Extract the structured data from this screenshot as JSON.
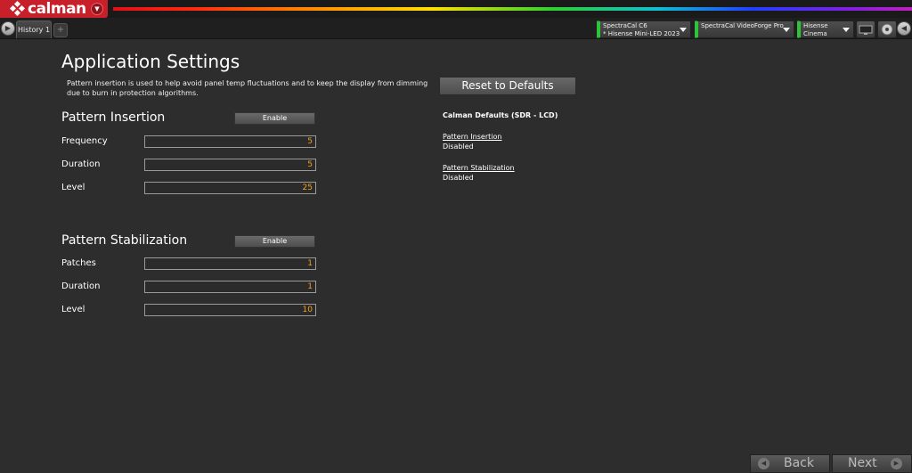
{
  "app": {
    "name": "calman",
    "brand_color": "#c8202a"
  },
  "tabs": {
    "history_label": "History 1",
    "add_label": "+"
  },
  "devices": [
    {
      "line1": "SpectraCal C6",
      "line2": "* Hisense Mini-LED 2023"
    },
    {
      "line1": "SpectraCal VideoForge Pro",
      "line2": ""
    },
    {
      "line1": "Hisense",
      "line2": "Cinema"
    }
  ],
  "page": {
    "title": "Application Settings",
    "description": "Pattern insertion is used to help avoid panel temp fluctuations and to keep the display from dimming due to burn in protection algorithms."
  },
  "pattern_insertion": {
    "title": "Pattern Insertion",
    "enable_label": "Enable",
    "fields": [
      {
        "label": "Frequency",
        "value": "5"
      },
      {
        "label": "Duration",
        "value": "5"
      },
      {
        "label": "Level",
        "value": "25"
      }
    ]
  },
  "pattern_stabilization": {
    "title": "Pattern Stabilization",
    "enable_label": "Enable",
    "fields": [
      {
        "label": "Patches",
        "value": "1"
      },
      {
        "label": "Duration",
        "value": "1"
      },
      {
        "label": "Level",
        "value": "10"
      }
    ]
  },
  "defaults": {
    "reset_label": "Reset to Defaults",
    "title": "Calman Defaults (SDR - LCD)",
    "items": [
      {
        "label": "Pattern Insertion",
        "value": "Disabled"
      },
      {
        "label": "Pattern Stabilization",
        "value": "Disabled"
      }
    ]
  },
  "nav": {
    "back_label": "Back",
    "next_label": "Next"
  },
  "colors": {
    "value_text": "#f0a020",
    "connected": "#2ec33a"
  }
}
